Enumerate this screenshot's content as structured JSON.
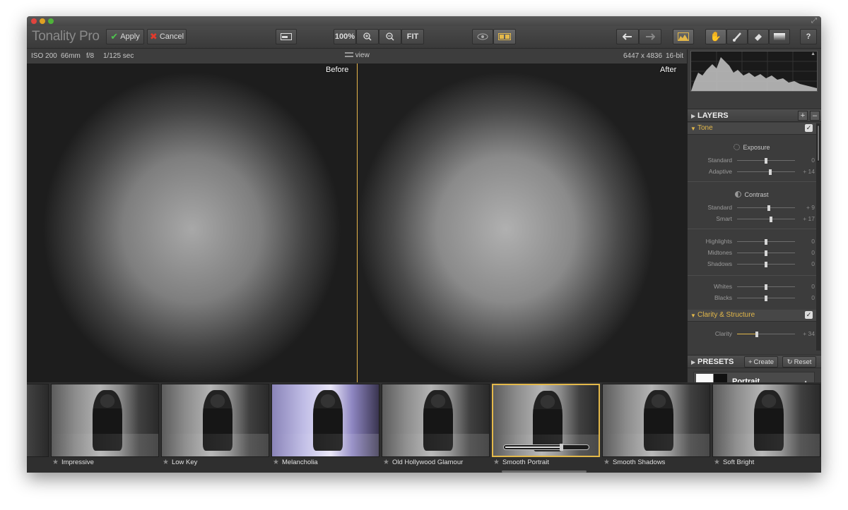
{
  "app": {
    "title": "Tonality Pro",
    "colors": {
      "accent": "#e3b84a",
      "panel": "#3b3b3b",
      "image_bg": "#1c1c1c"
    }
  },
  "toolbar": {
    "apply_label": "Apply",
    "cancel_label": "Cancel",
    "zoom_label": "100%",
    "fit_label": "FIT",
    "help_label": "?",
    "icons": [
      "window-toggle-icon",
      "zoom-in-icon",
      "zoom-out-icon",
      "eye-icon",
      "split-view-icon",
      "undo-icon",
      "redo-icon",
      "histogram-icon",
      "hand-icon",
      "brush-icon",
      "eraser-icon",
      "gradient-icon"
    ]
  },
  "info": {
    "iso": "ISO 200",
    "focal": "66mm",
    "aperture": "f/8",
    "shutter": "1/125 sec",
    "view": "view",
    "dimensions": "6447 x 4836",
    "bitdepth": "16-bit"
  },
  "viewer": {
    "before_label": "Before",
    "after_label": "After"
  },
  "layers": {
    "title": "LAYERS",
    "tone": {
      "title": "Tone",
      "exposure": {
        "title": "Exposure",
        "rows": [
          {
            "label": "Standard",
            "value": "0",
            "level": 0.5
          },
          {
            "label": "Adaptive",
            "value": "+ 14",
            "level": 0.57
          }
        ]
      },
      "contrast": {
        "title": "Contrast",
        "rows": [
          {
            "label": "Standard",
            "value": "+ 9",
            "level": 0.55
          },
          {
            "label": "Smart",
            "value": "+ 17",
            "level": 0.59
          }
        ]
      },
      "htones": {
        "rows": [
          {
            "label": "Highlights",
            "value": "0",
            "level": 0.5
          },
          {
            "label": "Midtones",
            "value": "0",
            "level": 0.5
          },
          {
            "label": "Shadows",
            "value": "0",
            "level": 0.5
          }
        ]
      },
      "wb": {
        "rows": [
          {
            "label": "Whites",
            "value": "0",
            "level": 0.5
          },
          {
            "label": "Blacks",
            "value": "0",
            "level": 0.5
          }
        ]
      }
    },
    "clarity": {
      "title": "Clarity & Structure",
      "rows": [
        {
          "label": "Clarity",
          "value": "+ 34",
          "level": 0.34
        }
      ]
    }
  },
  "presets": {
    "title": "PRESETS",
    "create_label": "Create",
    "reset_label": "Reset",
    "current": "Portrait"
  },
  "filmstrip": {
    "items": [
      {
        "label": "Impressive"
      },
      {
        "label": "Low Key"
      },
      {
        "label": "Melancholia"
      },
      {
        "label": "Old Hollywood Glamour"
      },
      {
        "label": "Smooth Portrait",
        "selected": true,
        "strength": 0.67
      },
      {
        "label": "Smooth Shadows"
      },
      {
        "label": "Soft Bright"
      }
    ]
  }
}
